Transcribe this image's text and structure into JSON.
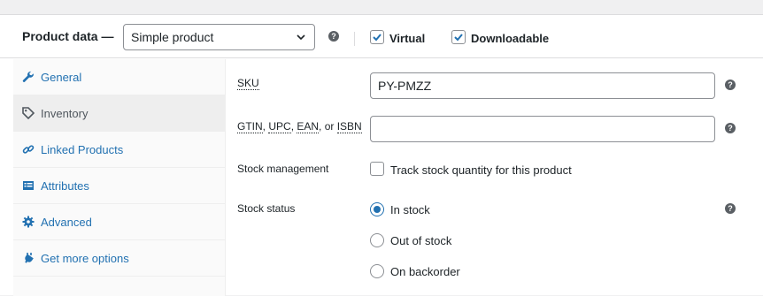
{
  "header": {
    "title": "Product data —",
    "product_type": "Simple product",
    "virtual_label": "Virtual",
    "virtual_checked": true,
    "downloadable_label": "Downloadable",
    "downloadable_checked": true
  },
  "sidebar": {
    "items": [
      {
        "label": "General",
        "icon": "wrench-icon",
        "active": false
      },
      {
        "label": "Inventory",
        "icon": "tag-icon",
        "active": true
      },
      {
        "label": "Linked Products",
        "icon": "link-icon",
        "active": false
      },
      {
        "label": "Attributes",
        "icon": "table-icon",
        "active": false
      },
      {
        "label": "Advanced",
        "icon": "gear-icon",
        "active": false
      },
      {
        "label": "Get more options",
        "icon": "plugin-icon",
        "active": false
      }
    ]
  },
  "inventory": {
    "sku_label": "SKU",
    "sku_value": "PY-PMZZ",
    "gtin_label_parts": [
      "GTIN",
      ", ",
      "UPC",
      ", ",
      "EAN",
      ", or ",
      "ISBN"
    ],
    "gtin_value": "",
    "stock_management_label": "Stock management",
    "track_stock_label": "Track stock quantity for this product",
    "track_stock_checked": false,
    "stock_status_label": "Stock status",
    "stock_status_options": [
      "In stock",
      "Out of stock",
      "On backorder"
    ],
    "stock_status_selected": "In stock"
  },
  "colors": {
    "accent": "#2271b1",
    "background": "#f0f0f1"
  }
}
